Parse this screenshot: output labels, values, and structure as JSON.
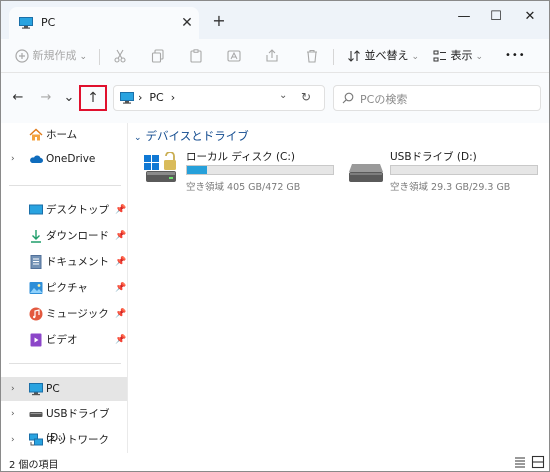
{
  "window": {
    "tab_title": "PC",
    "tab_close": "✕",
    "new_tab": "+",
    "minimize": "—",
    "maximize": "☐",
    "close": "✕"
  },
  "commands": {
    "new_label": "新規作成",
    "sort_label": "並べ替え",
    "view_label": "表示",
    "more": "•••"
  },
  "nav": {
    "back": "←",
    "forward": "→",
    "recent": "⌄",
    "up": "↑",
    "refresh": "↻"
  },
  "address": {
    "path": "PC",
    "separator": "›",
    "dropdown": "⌄"
  },
  "search": {
    "placeholder": "PCの検索"
  },
  "sidebar": {
    "items": [
      {
        "label": "ホーム",
        "icon": "home-icon",
        "expandable": false,
        "pinned": false
      },
      {
        "label": "OneDrive",
        "icon": "onedrive-icon",
        "expandable": true,
        "pinned": false
      },
      {
        "label": "デスクトップ",
        "icon": "desktop-icon",
        "expandable": false,
        "pinned": true
      },
      {
        "label": "ダウンロード",
        "icon": "download-icon",
        "expandable": false,
        "pinned": true
      },
      {
        "label": "ドキュメント",
        "icon": "documents-icon",
        "expandable": false,
        "pinned": true
      },
      {
        "label": "ピクチャ",
        "icon": "pictures-icon",
        "expandable": false,
        "pinned": true
      },
      {
        "label": "ミュージック",
        "icon": "music-icon",
        "expandable": false,
        "pinned": true
      },
      {
        "label": "ビデオ",
        "icon": "videos-icon",
        "expandable": false,
        "pinned": true
      },
      {
        "label": "PC",
        "icon": "pc-icon",
        "expandable": true,
        "pinned": false,
        "selected": true
      },
      {
        "label": "USBドライブ (D:)",
        "icon": "usb-drive-icon",
        "expandable": true,
        "pinned": false
      },
      {
        "label": "ネットワーク",
        "icon": "network-icon",
        "expandable": true,
        "pinned": false
      }
    ]
  },
  "main": {
    "group_title": "デバイスとドライブ",
    "drives": [
      {
        "name": "ローカル ディスク (C:)",
        "space": "空き領域 405 GB/472 GB",
        "used_fraction": 0.14
      },
      {
        "name": "USBドライブ (D:)",
        "space": "空き領域 29.3 GB/29.3 GB",
        "used_fraction": 0.0
      }
    ]
  },
  "status": {
    "item_count": "2 個の項目"
  },
  "colors": {
    "accent": "#26a0da",
    "highlight": "#e0102d",
    "group_title": "#104a8e"
  }
}
